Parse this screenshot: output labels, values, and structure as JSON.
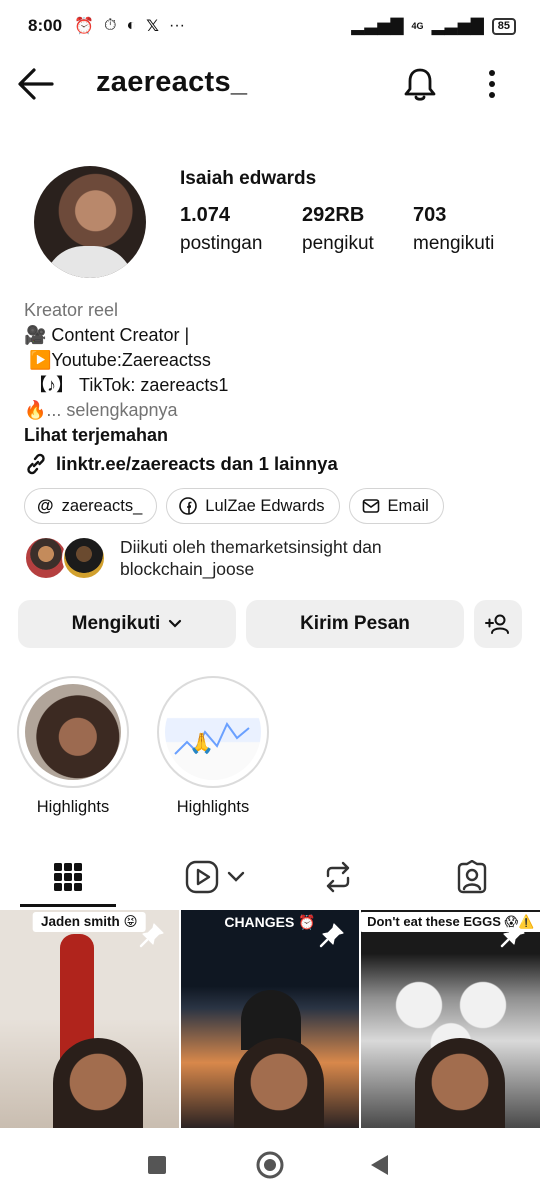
{
  "status_bar": {
    "time": "8:00",
    "notif_icons": [
      "alarm-clock-icon",
      "alarm-icon",
      "shield-icon",
      "x-logo-icon",
      "more-dots-icon"
    ],
    "more": "···",
    "network": "4G",
    "battery": "85"
  },
  "header": {
    "username": "zaereacts_"
  },
  "profile": {
    "full_name": "Isaiah edwards",
    "stats": [
      {
        "value": "1.074",
        "label": "postingan"
      },
      {
        "value": "292RB",
        "label": "pengikut"
      },
      {
        "value": "703",
        "label": "mengikuti"
      }
    ],
    "category": "Kreator reel",
    "bio_lines": [
      "🎥 Content Creator |",
      " ▶️Youtube:Zaereactss",
      " 【♪】 TikTok: zaereacts1"
    ],
    "bio_truncated_prefix": "🔥",
    "more_label": "... selengkapnya",
    "translate_label": "Lihat terjemahan",
    "link_text": "linktr.ee/zaereacts dan 1 lainnya"
  },
  "chips": [
    {
      "icon": "threads-icon",
      "label": "zaereacts_"
    },
    {
      "icon": "facebook-icon",
      "label": "LulZae Edwards"
    },
    {
      "icon": "mail-icon",
      "label": "Email"
    }
  ],
  "followed_by": {
    "line1": "Diikuti oleh themarketsinsight dan",
    "line2": "blockchain_joose"
  },
  "actions": {
    "following_label": "Mengikuti",
    "message_label": "Kirim Pesan"
  },
  "highlights": [
    {
      "label": "Highlights"
    },
    {
      "label": "Highlights"
    }
  ],
  "grid_posts": [
    {
      "caption": "Jaden smith 😝"
    },
    {
      "caption": "CHANGES ⏰"
    },
    {
      "caption": "Don't eat these EGGS 😱⚠️"
    }
  ],
  "colors": {
    "button_bg": "#efefef",
    "secondary_text": "#737373",
    "text": "#111111"
  }
}
